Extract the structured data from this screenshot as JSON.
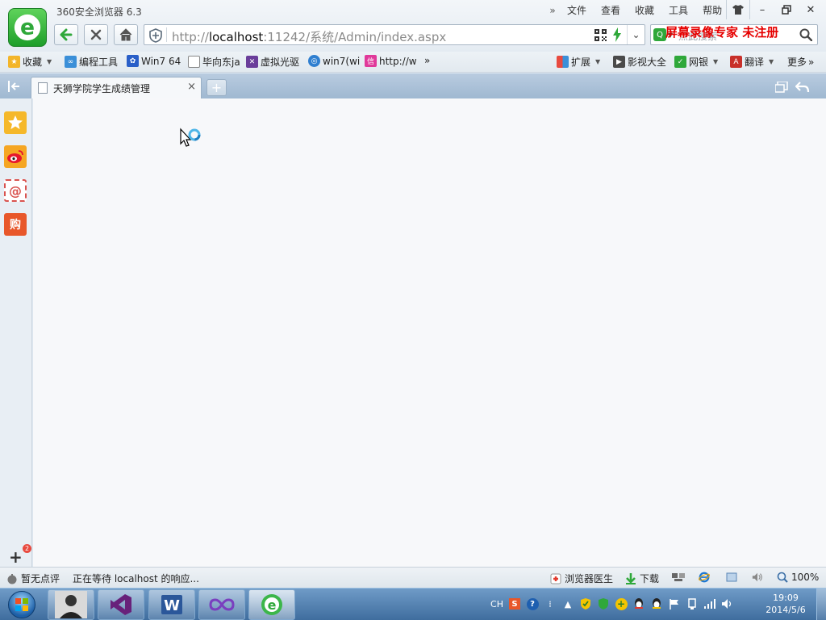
{
  "app": {
    "title": "360安全浏览器 6.3"
  },
  "menu": {
    "items": [
      "文件",
      "查看",
      "收藏",
      "工具",
      "帮助"
    ],
    "more_icon": "double-chevron-right-icon"
  },
  "window_controls": [
    "skin-icon",
    "minimize-icon",
    "restore-icon",
    "close-icon"
  ],
  "address": {
    "url_prefix": "http://",
    "url_host": "localhost",
    "url_rest": ":11242/系统/Admin/index.aspx"
  },
  "search": {
    "placeholder": "点此搜索"
  },
  "watermark": "屏幕录像专家  未注册",
  "bookmarks": {
    "left": [
      {
        "label": "收藏",
        "icon": "star-icon",
        "dropdown": true
      },
      {
        "label": "编程工具",
        "icon": "folder-icon"
      },
      {
        "label": "Win7 64",
        "icon": "paw-icon"
      },
      {
        "label": "毕向东ja",
        "icon": "page-icon"
      },
      {
        "label": "虚拟光驱",
        "icon": "disc-icon"
      },
      {
        "label": "win7(wi",
        "icon": "globe-icon"
      },
      {
        "label": "http://w",
        "icon": "pink-icon"
      }
    ],
    "right": [
      {
        "label": "扩展",
        "icon": "grid-icon",
        "dropdown": true
      },
      {
        "label": "影视大全",
        "icon": "film-icon"
      },
      {
        "label": "网银",
        "icon": "shield-icon",
        "dropdown": true
      },
      {
        "label": "翻译",
        "icon": "translate-icon",
        "dropdown": true
      },
      {
        "label": "更多",
        "icon": "double-chevron-right-icon"
      }
    ]
  },
  "tab": {
    "title": "天狮学院学生成绩管理",
    "close": "×"
  },
  "newtab": {
    "label": "+"
  },
  "sidebar": {
    "badge": "2",
    "add": "+"
  },
  "status": {
    "rating": "暂无点评",
    "loading": "正在等待 localhost 的响应...",
    "doctor": "浏览器医生",
    "download": "下载",
    "zoom": "100%"
  },
  "taskbar": {
    "apps": [
      "user-photo",
      "visual-studio",
      "word",
      "infinity-app",
      "360-browser"
    ],
    "tray_lang": "CH",
    "time": "19:09",
    "date": "2014/5/6"
  },
  "colors": {
    "accent_green": "#2fa83a",
    "watermark_red": "#e60000",
    "tabstrip": "#9fb8d1"
  }
}
